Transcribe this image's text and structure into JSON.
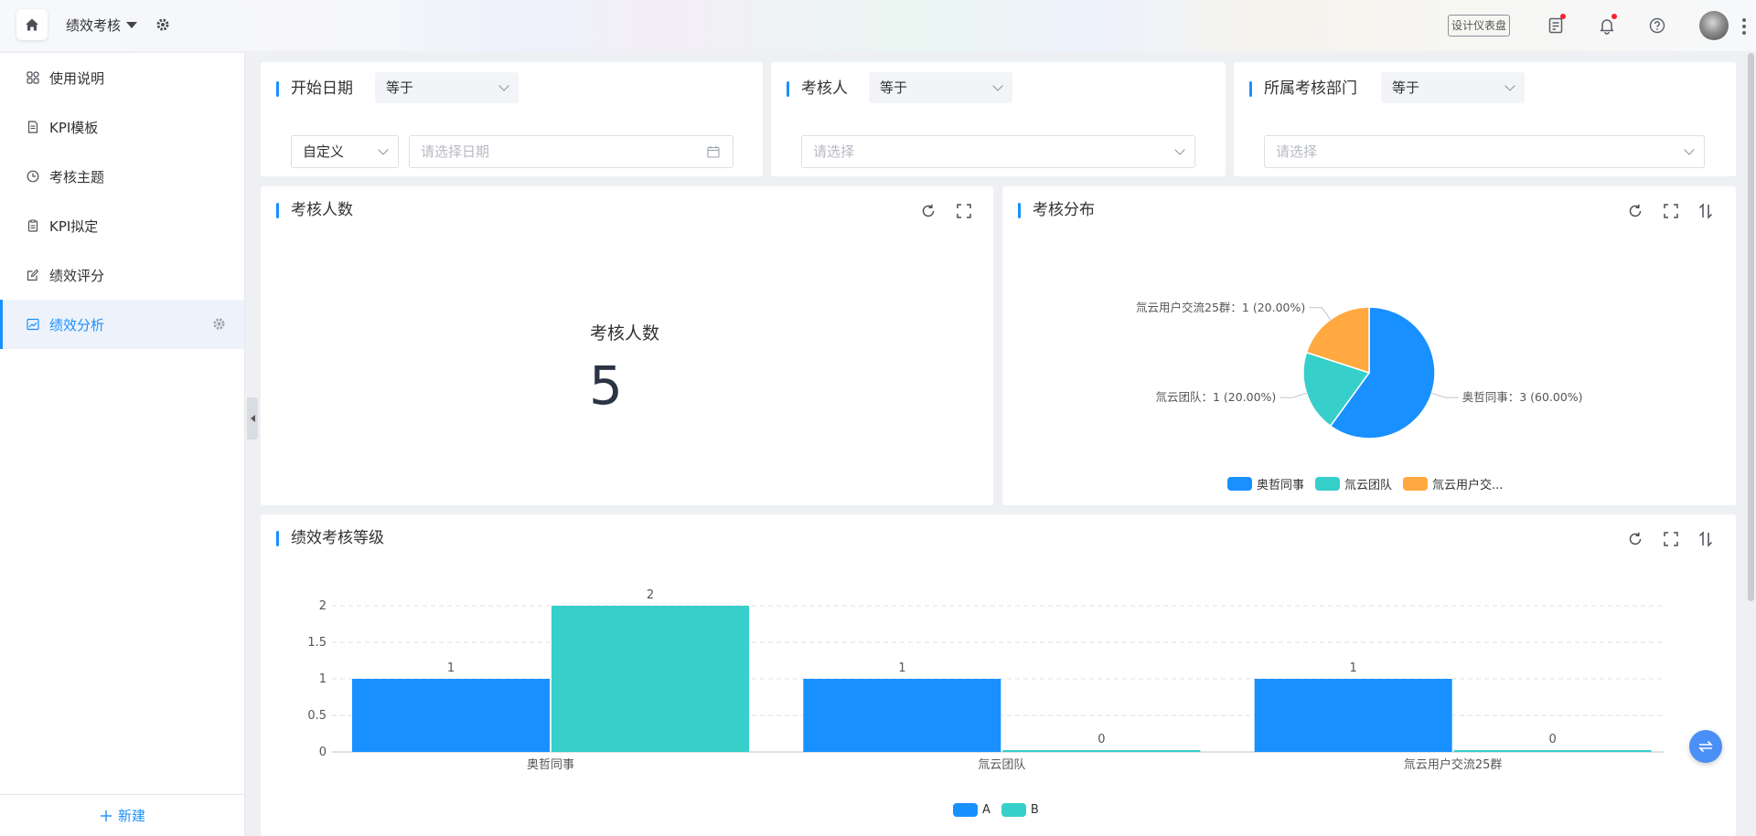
{
  "header": {
    "app_title": "绩效考核",
    "design_button": "设计仪表盘"
  },
  "sidebar": {
    "items": [
      {
        "label": "使用说明",
        "icon": "grid-icon"
      },
      {
        "label": "KPI模板",
        "icon": "document-icon"
      },
      {
        "label": "考核主题",
        "icon": "clock-icon"
      },
      {
        "label": "KPI拟定",
        "icon": "clipboard-icon"
      },
      {
        "label": "绩效评分",
        "icon": "edit-icon"
      },
      {
        "label": "绩效分析",
        "icon": "chart-line-icon",
        "active": true
      }
    ],
    "new_button": "新建"
  },
  "filters": [
    {
      "title": "开始日期",
      "operator": "等于",
      "mode": "自定义",
      "placeholder": "请选择日期"
    },
    {
      "title": "考核人",
      "operator": "等于",
      "placeholder": "请选择"
    },
    {
      "title": "所属考核部门",
      "operator": "等于",
      "placeholder": "请选择"
    }
  ],
  "headcount": {
    "title": "考核人数",
    "label": "考核人数",
    "value": "5"
  },
  "distribution": {
    "title": "考核分布",
    "labels": [
      "奥哲同事：3 (60.00%)",
      "氚云团队：1 (20.00%)",
      "氚云用户交流25群：1 (20.00%)"
    ],
    "legend": [
      "奥哲同事",
      "氚云团队",
      "氚云用户交..."
    ]
  },
  "grade": {
    "title": "绩效考核等级",
    "legend": [
      "A",
      "B"
    ]
  },
  "colors": {
    "accent": "#1890ff",
    "series_a": "#1890ff",
    "series_b": "#36cfc9",
    "series_c": "#ffa940"
  },
  "chart_data": [
    {
      "type": "pie",
      "title": "考核分布",
      "categories": [
        "奥哲同事",
        "氚云团队",
        "氚云用户交流25群"
      ],
      "values": [
        3,
        1,
        1
      ],
      "percentages": [
        60,
        20,
        20
      ],
      "legend_position": "bottom"
    },
    {
      "type": "bar",
      "title": "绩效考核等级",
      "categories": [
        "奥哲同事",
        "氚云团队",
        "氚云用户交流25群"
      ],
      "series": [
        {
          "name": "A",
          "values": [
            1,
            1,
            1
          ]
        },
        {
          "name": "B",
          "values": [
            2,
            0,
            0
          ]
        }
      ],
      "ylim": [
        0,
        2
      ],
      "yticks": [
        "0",
        "0.5",
        "1",
        "1.5",
        "2"
      ],
      "grid": true,
      "legend_position": "bottom"
    }
  ]
}
